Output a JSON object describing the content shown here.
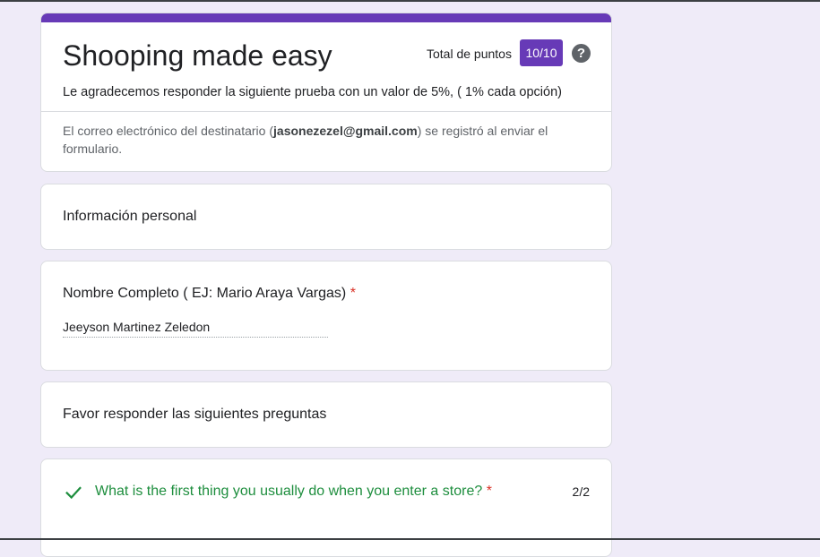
{
  "form": {
    "title": "Shooping made easy",
    "score_label": "Total de puntos",
    "score": "10/10",
    "description": "Le agradecemos responder la siguiente prueba con un valor de 5%, ( 1% cada opción)",
    "email_note_before": "El correo electrónico del destinatario (",
    "email": "jasonezezel@gmail.com",
    "email_note_after": ") se registró al enviar el formulario.",
    "accent_color": "#673ab7"
  },
  "sections": {
    "personal_info": "Información personal",
    "answer_prompt": "Favor responder las siguientes preguntas"
  },
  "questions": [
    {
      "label": "Nombre Completo ( EJ: Mario Araya Vargas)",
      "required_mark": "*",
      "answer": "Jeeyson Martinez Zeledon"
    },
    {
      "label": "What is the first thing you usually do when you enter a store?",
      "required_mark": "*",
      "score": "2/2",
      "status_icon": "check-icon",
      "correct_color": "#1e8e3e"
    }
  ]
}
